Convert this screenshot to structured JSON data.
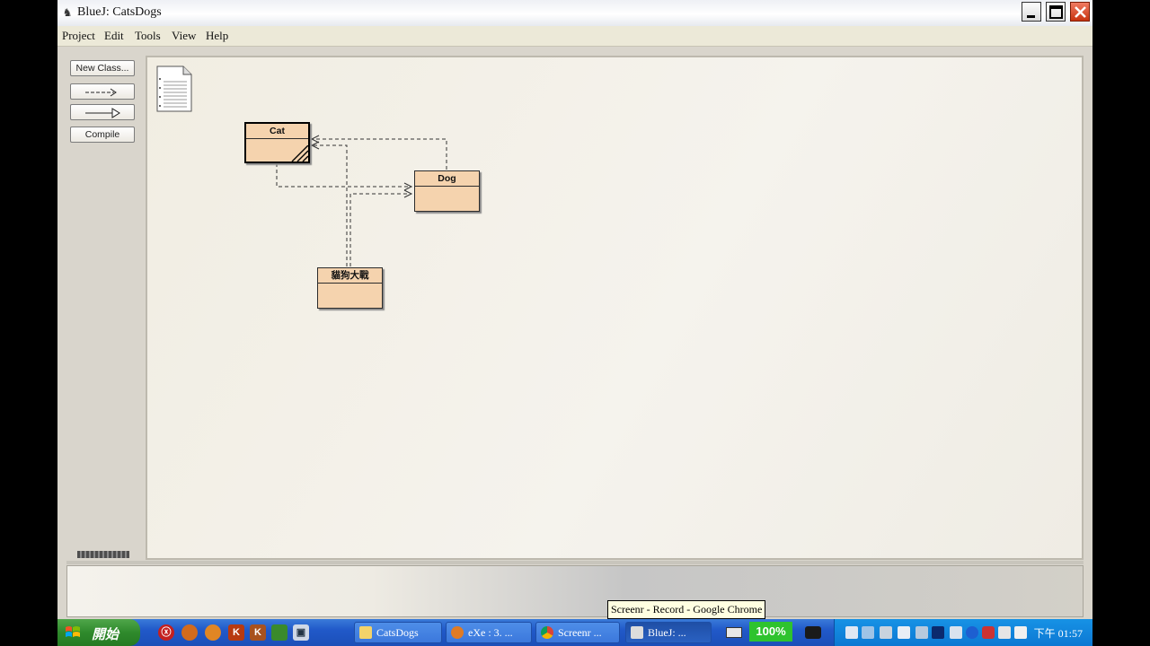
{
  "window": {
    "title": "BlueJ:  CatsDogs",
    "app_icon": "bluej-icon",
    "controls": [
      "minimize",
      "maximize",
      "close"
    ]
  },
  "menubar": {
    "items": [
      {
        "label": "Project",
        "icon": ""
      },
      {
        "label": "Edit",
        "icon": ""
      },
      {
        "label": "Tools",
        "icon": ""
      },
      {
        "label": "View",
        "icon": ""
      },
      {
        "label": "Help",
        "icon": ""
      }
    ]
  },
  "toolbar": {
    "new_class_label": "New Class...",
    "uses_arrow_icon": "dashed-arrow-icon",
    "inherits_arrow_icon": "solid-arrow-icon",
    "compile_label": "Compile"
  },
  "diagram": {
    "readme_icon": "readme-document-icon",
    "classes": [
      {
        "name": "Cat",
        "selected": true,
        "uncompiled": true
      },
      {
        "name": "Dog",
        "selected": false,
        "uncompiled": false
      },
      {
        "name": "貓狗大戰",
        "selected": false,
        "uncompiled": false
      }
    ],
    "class_color": "#f5d3ae"
  },
  "taskbar": {
    "start_label": "開始",
    "buttons": [
      {
        "label": "CatsDogs",
        "icon": "folder-icon"
      },
      {
        "label": "eXe : 3. ...",
        "icon": "firefox-icon"
      },
      {
        "label": "Screenr ...",
        "icon": "chrome-icon"
      },
      {
        "label": "BlueJ: ...",
        "icon": "bluej-icon"
      }
    ],
    "zoom": "100%",
    "clock": "下午 01:57"
  },
  "tooltip": "Screenr - Record - Google Chrome"
}
